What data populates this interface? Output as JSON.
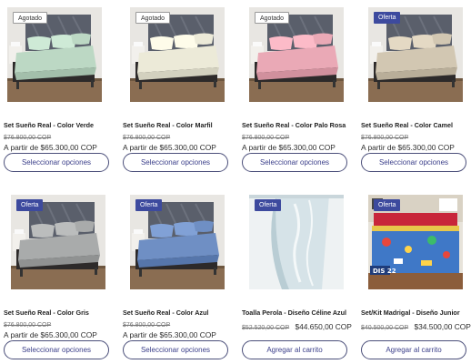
{
  "products": [
    {
      "title": "Set Sueño Real - Color Verde",
      "badge": "Agotado",
      "badge_type": "sold",
      "old_price": "$76.800,00 COP",
      "price": "A partir de $65.300,00 COP",
      "button": "Seleccionar opciones",
      "image": "bed",
      "sheet_color": "#bcd8c4"
    },
    {
      "title": "Set Sueño Real - Color Marfil",
      "badge": "Agotado",
      "badge_type": "sold",
      "old_price": "$76.800,00 COP",
      "price": "A partir de $65.300,00 COP",
      "button": "Seleccionar opciones",
      "image": "bed",
      "sheet_color": "#ecead8"
    },
    {
      "title": "Set Sueño Real - Color Palo Rosa",
      "badge": "Agotado",
      "badge_type": "sold",
      "old_price": "$76.800,00 COP",
      "price": "A partir de $65.300,00 COP",
      "button": "Seleccionar opciones",
      "image": "bed",
      "sheet_color": "#eaa9b6"
    },
    {
      "title": "Set Sueño Real - Color Camel",
      "badge": "Oferta",
      "badge_type": "sale",
      "old_price": "$76.800,00 COP",
      "price": "A partir de $65.300,00 COP",
      "button": "Seleccionar opciones",
      "image": "bed",
      "sheet_color": "#d2c7b2"
    },
    {
      "title": "Set Sueño Real - Color Gris",
      "badge": "Oferta",
      "badge_type": "sale",
      "old_price": "$76.800,00 COP",
      "price": "A partir de $65.300,00 COP",
      "button": "Seleccionar opciones",
      "image": "bed",
      "sheet_color": "#a9abab"
    },
    {
      "title": "Set Sueño Real - Color Azul",
      "badge": "Oferta",
      "badge_type": "sale",
      "old_price": "$76.800,00 COP",
      "price": "A partir de $65.300,00 COP",
      "button": "Seleccionar opciones",
      "image": "bed",
      "sheet_color": "#6f8fc4"
    },
    {
      "title": "Toalla Perola - Diseño Céline Azul",
      "badge": "Oferta",
      "badge_type": "sale",
      "old_price": "$52.520,00 COP",
      "price": "$44.650,00 COP",
      "button": "Agregar al carrito",
      "image": "towel",
      "sheet_color": "#d6e3e8"
    },
    {
      "title": "Set/Kit Madrigal - Diseño Junior",
      "badge": "Oferta",
      "badge_type": "sale",
      "old_price": "$40.500,00 COP",
      "price": "$34.500,00 COP",
      "button": "Agregar al carrito",
      "image": "kids",
      "sheet_color": "#3f78c7",
      "image_caption": "DIS 22"
    }
  ]
}
